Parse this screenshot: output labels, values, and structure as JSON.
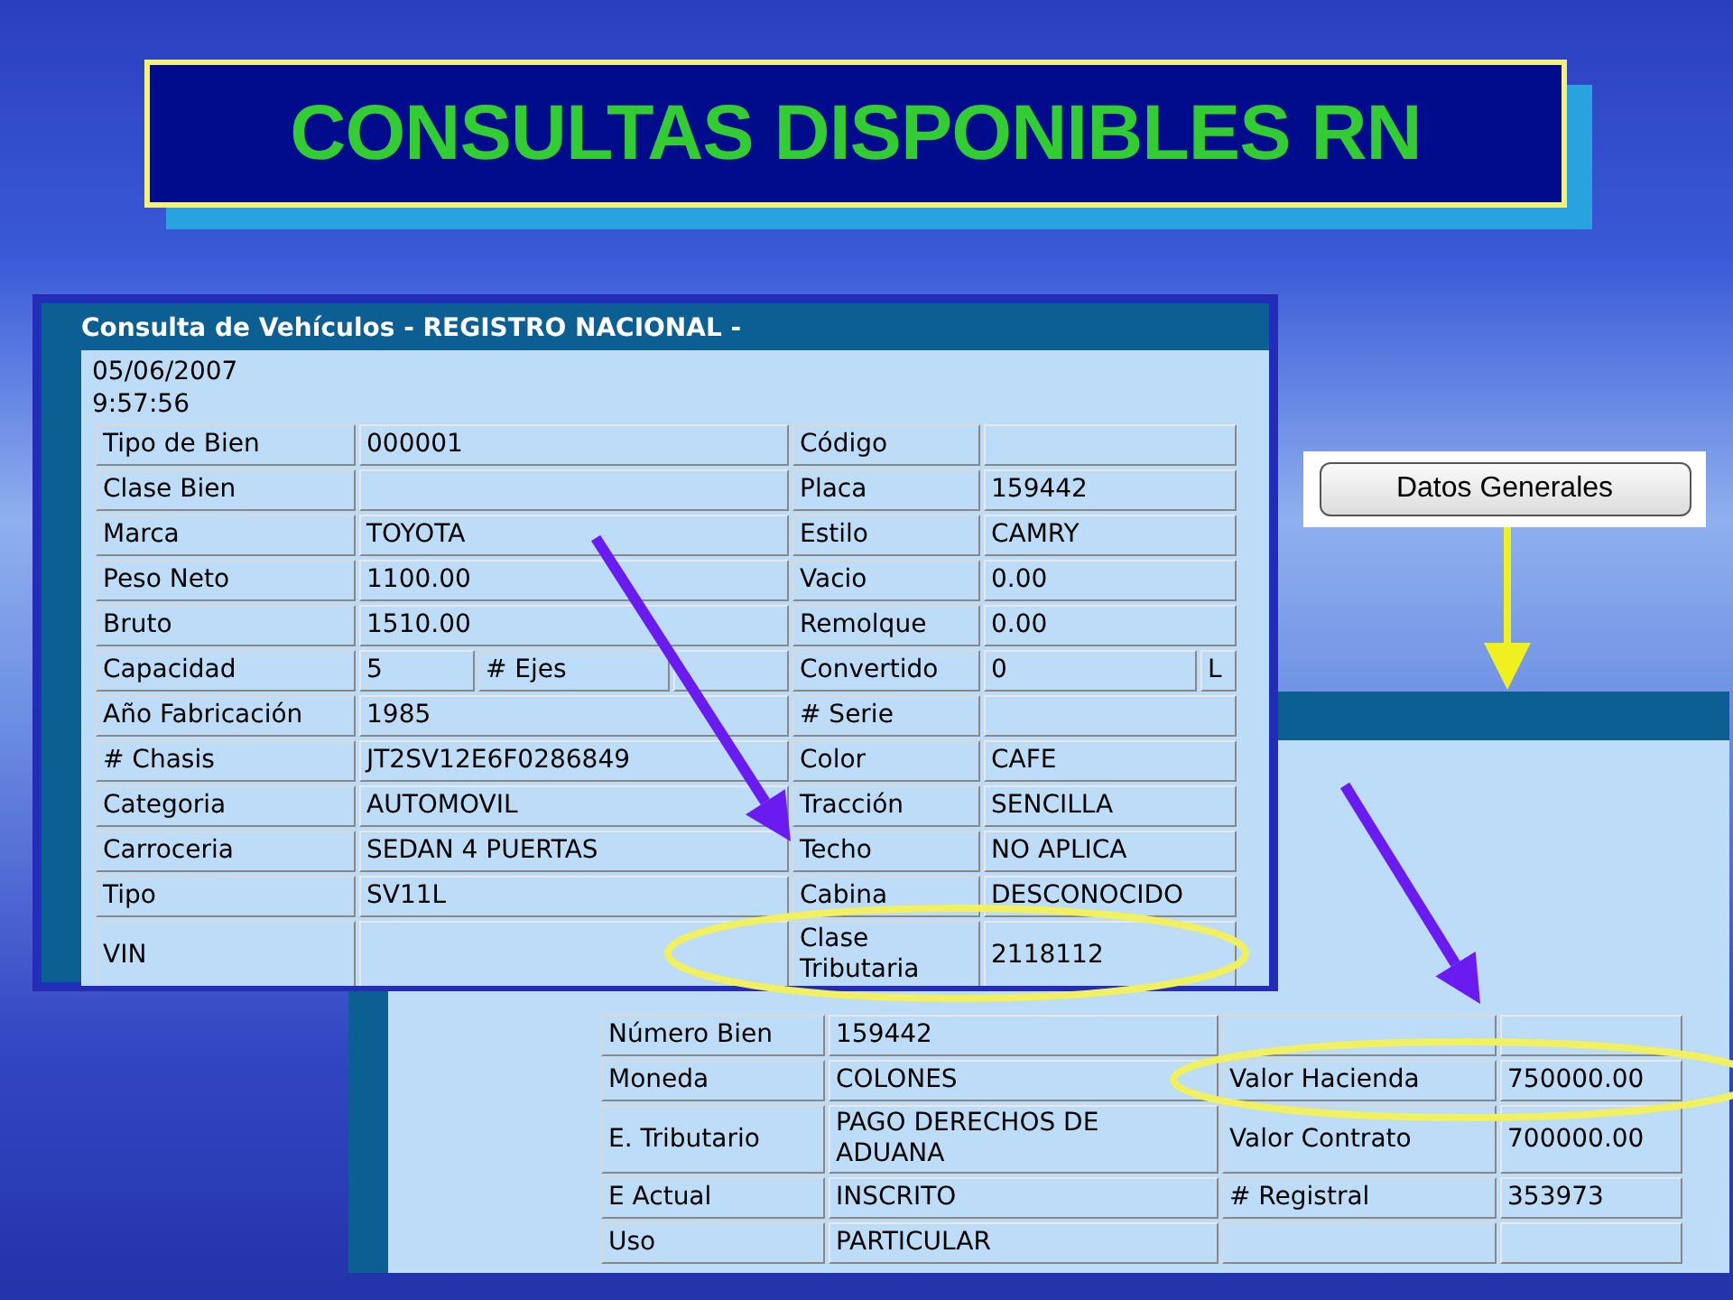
{
  "slide_title": "CONSULTAS DISPONIBLES RN",
  "vehicle_window": {
    "title": "Consulta de Vehículos - REGISTRO NACIONAL -",
    "date": "05/06/2007",
    "time": "9:57:56",
    "rows": [
      {
        "label": "Tipo de Bien",
        "value": "000001",
        "label_2": "Código"
      },
      {
        "label": "Clase Bien",
        "label_2": "Placa",
        "value_2": "159442"
      },
      {
        "label": "Marca",
        "value": "TOYOTA",
        "label_2": "Estilo",
        "value_2": "CAMRY"
      },
      {
        "label": "Peso Neto",
        "value": "1100.00",
        "label_2": "Vacio",
        "value_2": "0.00"
      },
      {
        "label": "Bruto",
        "value": "1510.00",
        "label_2": "Remolque",
        "value_2": "0.00"
      },
      {
        "label": "Capacidad",
        "value": "5",
        "label_extra": "# Ejes",
        "label_2": "Convertido",
        "value_2": "0",
        "column_5": "L"
      },
      {
        "label": "Año Fabricación",
        "value": "1985",
        "label_2": "# Serie"
      },
      {
        "label": "# Chasis",
        "value": "JT2SV12E6F0286849",
        "label_2": "Color",
        "value_2": "CAFE"
      },
      {
        "label": "Categoria",
        "value": "AUTOMOVIL",
        "label_2": "Tracción",
        "value_2": "SENCILLA"
      },
      {
        "label": "Carroceria",
        "value": "SEDAN 4 PUERTAS",
        "label_2": "Techo",
        "value_2": "NO APLICA"
      },
      {
        "label": "Tipo",
        "value": "SV11L",
        "label_2": "Cabina",
        "value_2": "DESCONOCIDO"
      },
      {
        "label": "VIN",
        "label_2": "Clase Tributaria",
        "value_2": "2118112"
      }
    ]
  },
  "general_button": {
    "label": "Datos Generales"
  },
  "general_window": {
    "rows": [
      {
        "label": "Número Bien",
        "value": "159442"
      },
      {
        "label": "Moneda",
        "value": "COLONES",
        "label_2": "Valor Hacienda",
        "value_2": "750000.00"
      },
      {
        "label": "E. Tributario",
        "value": "PAGO DERECHOS DE ADUANA",
        "label_2": "Valor Contrato",
        "value_2": "700000.00"
      },
      {
        "label": "E Actual",
        "value": "INSCRITO",
        "label_2": "# Registral",
        "value_2": "353973"
      },
      {
        "label": "Uso",
        "value": "PARTICULAR"
      }
    ]
  }
}
